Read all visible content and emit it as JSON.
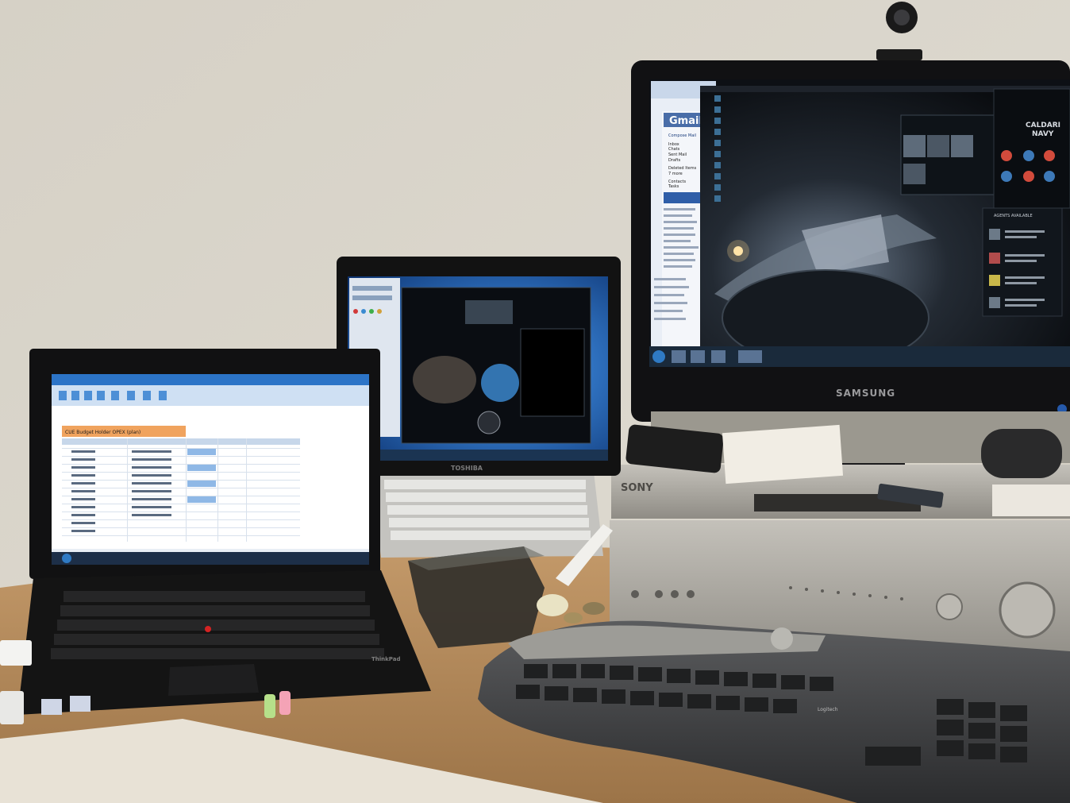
{
  "photo": {
    "description_free": true
  },
  "monitor": {
    "brand": "SAMSUNG",
    "gmail": {
      "logo": "Gmail",
      "compose": "Compose Mail",
      "items": [
        "Inbox",
        "Chats",
        "Sent Mail",
        "Drafts",
        "Deleted Items",
        "7 more",
        "Contacts",
        "Tasks"
      ]
    },
    "game": {
      "corp_title_line1": "CALDARI",
      "corp_title_line2": "NAVY",
      "panel_heading": "AGENTS AVAILABLE"
    }
  },
  "center_laptop": {
    "brand": "TOSHIBA"
  },
  "left_laptop": {
    "brand": "ThinkPad",
    "sheet_title": "CUE Budget Holder OPEX (plan)"
  },
  "receiver": {
    "brand": "SONY"
  },
  "keyboard": {
    "brand": "Logitech"
  },
  "colors": {
    "wall": "#d8d3c8",
    "desk": "#b08a5e",
    "screen_blue": "#2f6fbd",
    "excel_orange": "#e07a2c",
    "silver": "#a7a49d"
  }
}
